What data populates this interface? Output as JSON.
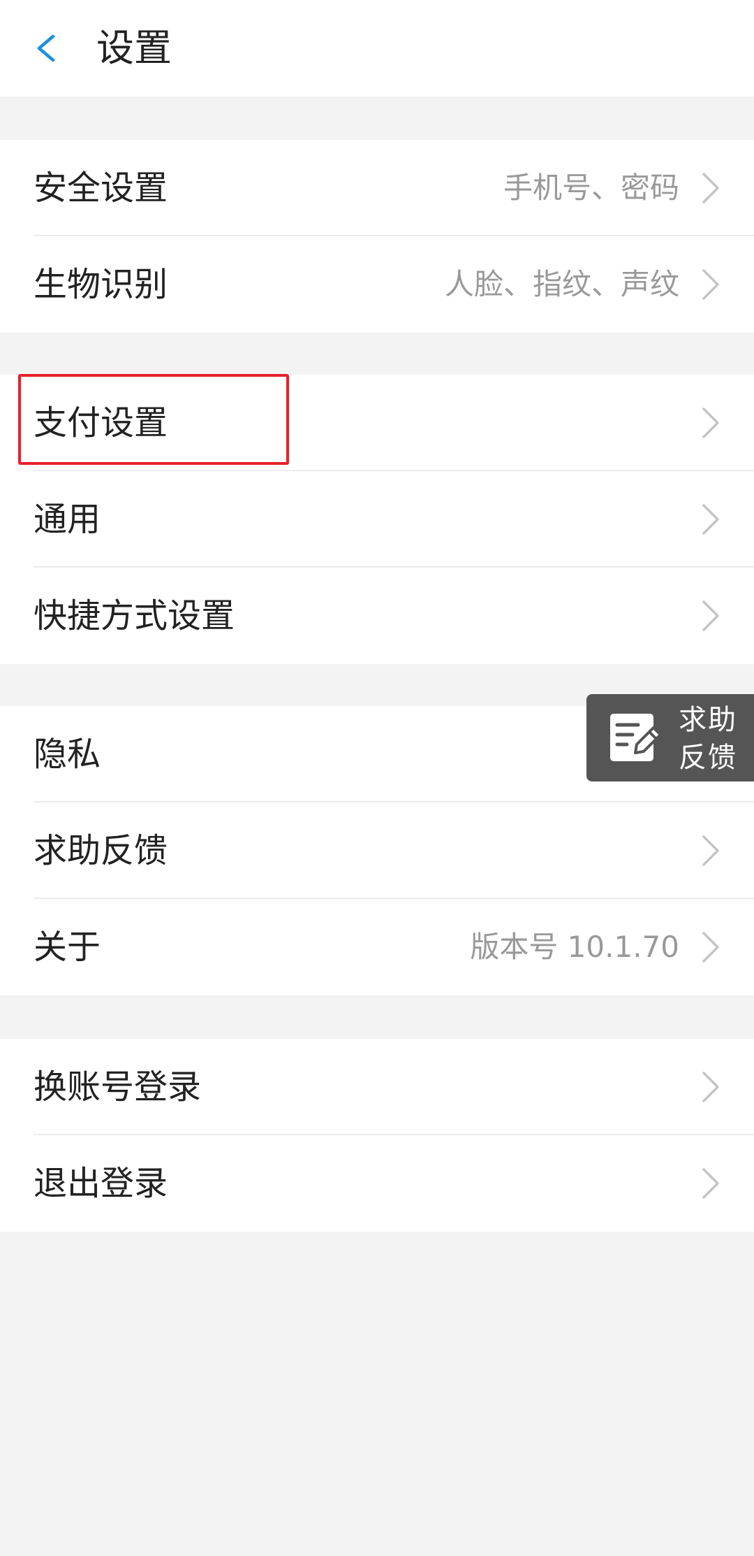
{
  "header": {
    "title": "设置",
    "back_icon": "chevron-left-icon",
    "back_color": "#1a8fe3"
  },
  "groups": [
    {
      "items": [
        {
          "label": "安全设置",
          "value": "手机号、密码"
        },
        {
          "label": "生物识别",
          "value": "人脸、指纹、声纹"
        }
      ]
    },
    {
      "items": [
        {
          "label": "支付设置",
          "value": "",
          "highlighted": true
        },
        {
          "label": "通用",
          "value": ""
        },
        {
          "label": "快捷方式设置",
          "value": ""
        }
      ]
    },
    {
      "items": [
        {
          "label": "隐私",
          "value": ""
        },
        {
          "label": "求助反馈",
          "value": ""
        },
        {
          "label": "关于",
          "value": "版本号 10.1.70"
        }
      ]
    },
    {
      "items": [
        {
          "label": "换账号登录",
          "value": ""
        },
        {
          "label": "退出登录",
          "value": ""
        }
      ]
    }
  ],
  "floating_feedback": {
    "line1": "求助",
    "line2": "反馈",
    "icon": "edit-note-icon"
  },
  "colors": {
    "highlight_border": "#e8212a",
    "chevron": "#c4c4c4",
    "value_text": "#999999"
  }
}
